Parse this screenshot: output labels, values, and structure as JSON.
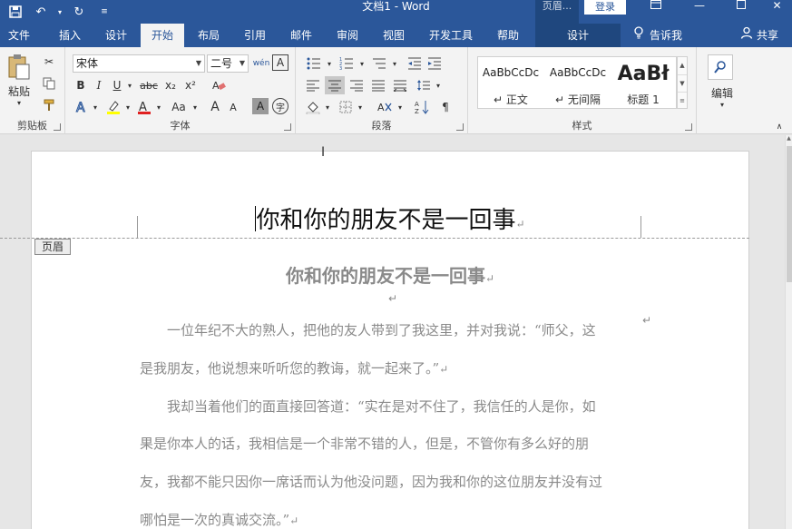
{
  "titlebar": {
    "doc_title": "文档1 - Word",
    "ctx_title": "页眉...",
    "login": "登录"
  },
  "tabs": [
    "文件",
    "插入",
    "设计",
    "开始",
    "布局",
    "引用",
    "邮件",
    "审阅",
    "视图",
    "开发工具",
    "帮助",
    "设计"
  ],
  "active_tab": "开始",
  "tellme": "告诉我",
  "share": "共享",
  "ribbon": {
    "clipboard": {
      "paste": "粘贴",
      "label": "剪贴板"
    },
    "font": {
      "name": "宋体",
      "size": "二号",
      "label": "字体",
      "bold": "B",
      "italic": "I",
      "underline": "U",
      "strike": "abc",
      "sub": "x₂",
      "sup": "x²",
      "grow": "A",
      "shrink": "A",
      "case": "Aa",
      "char_border": "A",
      "char_shade": "A",
      "phonetic": "wén",
      "circled": "字"
    },
    "paragraph": {
      "label": "段落"
    },
    "styles": {
      "label": "样式",
      "items": [
        {
          "sample": "AaBbCcDc",
          "name": "正文"
        },
        {
          "sample": "AaBbCcDc",
          "name": "无间隔"
        },
        {
          "sample": "AaBł",
          "name": "标题 1"
        }
      ]
    },
    "editing": {
      "label": "编辑"
    }
  },
  "document": {
    "header_tab": "页眉",
    "header_text": "你和你的朋友不是一回事",
    "heading": "你和你的朋友不是一回事",
    "lines": [
      "　　一位年纪不大的熟人，把他的友人带到了我这里，并对我说：“师父，这",
      "是我朋友，他说想来听听您的教诲，就一起来了。”",
      "　　我却当着他们的面直接回答道：“实在是对不住了，我信任的人是你，如",
      "果是你本人的话，我相信是一个非常不错的人，但是，不管你有多么好的朋",
      "友，我都不能只因你一席话而认为他没问题，因为我和你的这位朋友并没有过",
      "哪怕是一次的真诚交流。”"
    ],
    "para_mark": "↵"
  }
}
